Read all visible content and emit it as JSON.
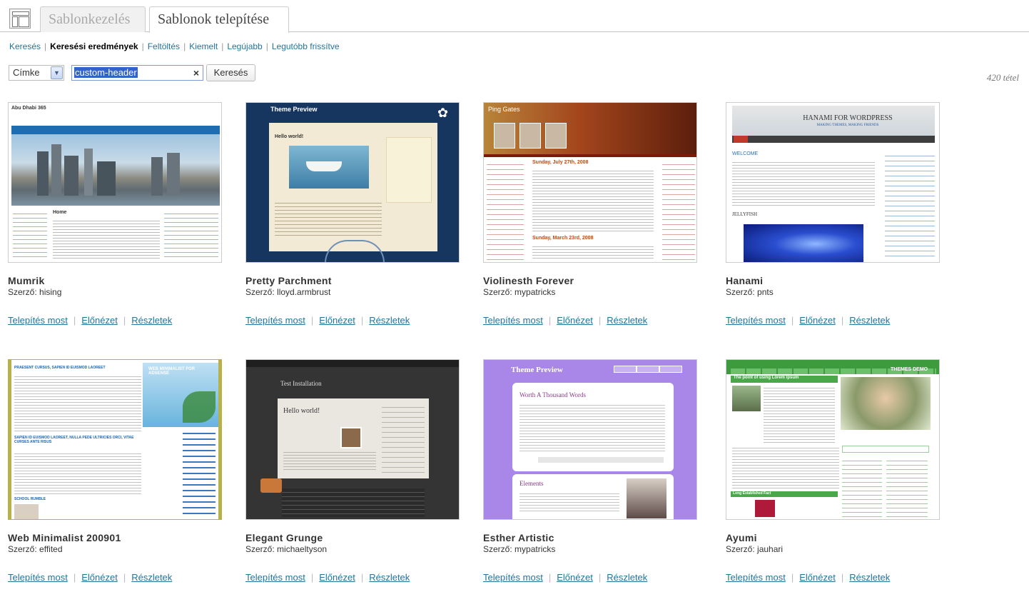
{
  "header": {
    "tabs": [
      {
        "label": "Sablonkezelés",
        "active": false
      },
      {
        "label": "Sablonok telepítése",
        "active": true
      }
    ]
  },
  "filters": {
    "items": [
      "Keresés",
      "Keresési eredmények",
      "Feltöltés",
      "Kiemelt",
      "Legújabb",
      "Legutóbb frissítve"
    ],
    "current": "Keresési eredmények"
  },
  "search": {
    "type_selected": "Címke",
    "value": "custom-header",
    "button_label": "Keresés",
    "result_count": "420 tétel"
  },
  "actions": {
    "install": "Telepítés most",
    "preview": "Előnézet",
    "details": "Részletek"
  },
  "author_prefix": "Szerző:",
  "themes": [
    {
      "name": "Mumrik",
      "author": "hising"
    },
    {
      "name": "Pretty Parchment",
      "author": "lloyd.armbrust"
    },
    {
      "name": "Violinesth Forever",
      "author": "mypatricks"
    },
    {
      "name": "Hanami",
      "author": "pnts"
    },
    {
      "name": "Web Minimalist 200901",
      "author": "effited"
    },
    {
      "name": "Elegant Grunge",
      "author": "michaeltyson"
    },
    {
      "name": "Esther Artistic",
      "author": "mypatricks"
    },
    {
      "name": "Ayumi",
      "author": "jauhari"
    }
  ],
  "thumbnails": {
    "mumrik": {
      "site_title": "Abu Dhabi 365",
      "heading": "Home"
    },
    "pretty_parchment": {
      "site_title": "Theme Preview",
      "post_title": "Hello world!"
    },
    "violinesth": {
      "site_title": "Ping Gates",
      "post_date_1": "Sunday, July 27th, 2008",
      "post_date_2": "Sunday, March 23rd, 2008"
    },
    "hanami": {
      "site_title": "HANAMI FOR WORDPRESS",
      "tagline": "MAKING THEMES, MAKING FRIENDS",
      "welcome": "WELCOME",
      "post2": "JELLYFISH"
    },
    "web_minimalist": {
      "headline_1": "PRAESENT CURSUS, SAPIEN ID EUISMOD LAOREET",
      "logo": "WEB MINIMALIST FOR ADSENSE",
      "headline_2": "SAPIEN ID EUISMOD LAOREET, NULLA PEDE ULTRICIES ORCI, VITAE CURSES ANTE RISUS",
      "headline_3": "SCHOOL RUMBLE"
    },
    "elegant_grunge": {
      "site_title": "Test Installation",
      "post_title": "Hello world!"
    },
    "esther": {
      "site_title": "Theme Preview",
      "post_title": "Worth A Thousand Words",
      "section": "Elements"
    },
    "ayumi": {
      "banner": "THEMES DEMO",
      "post_title": "The point of using Lorem Ipsum",
      "post2": "Long Established Fact"
    }
  },
  "colors": {
    "link": "#21759b",
    "tab_active_text": "#464646",
    "tab_inactive_text": "#aaaaaa"
  }
}
